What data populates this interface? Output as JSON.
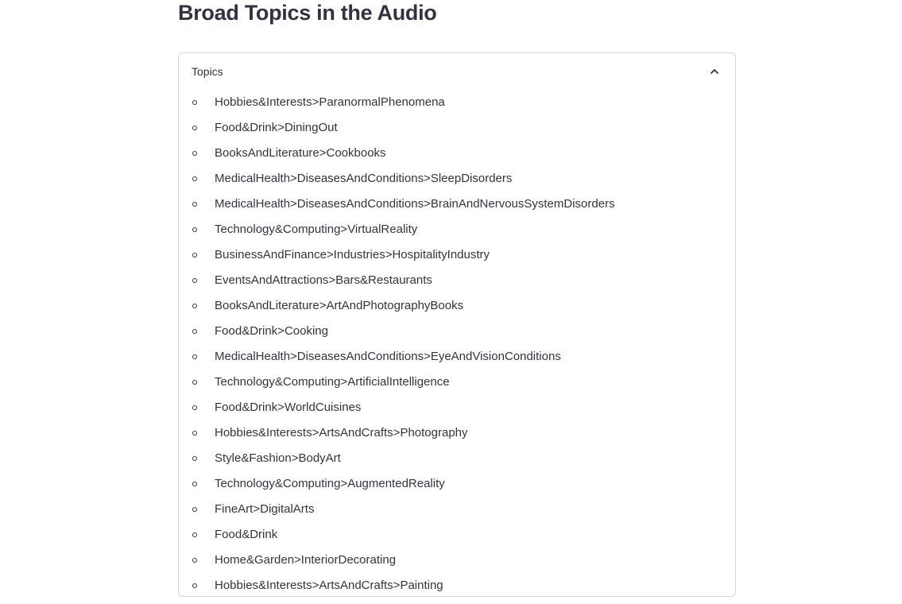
{
  "page": {
    "title": "Broad Topics in the Audio"
  },
  "expander": {
    "label": "Topics",
    "expanded": true,
    "toggle_icon": "chevron-up-icon",
    "items": [
      "Hobbies&Interests>ParanormalPhenomena",
      "Food&Drink>DiningOut",
      "BooksAndLiterature>Cookbooks",
      "MedicalHealth>DiseasesAndConditions>SleepDisorders",
      "MedicalHealth>DiseasesAndConditions>BrainAndNervousSystemDisorders",
      "Technology&Computing>VirtualReality",
      "BusinessAndFinance>Industries>HospitalityIndustry",
      "EventsAndAttractions>Bars&Restaurants",
      "BooksAndLiterature>ArtAndPhotographyBooks",
      "Food&Drink>Cooking",
      "MedicalHealth>DiseasesAndConditions>EyeAndVisionConditions",
      "Technology&Computing>ArtificialIntelligence",
      "Food&Drink>WorldCuisines",
      "Hobbies&Interests>ArtsAndCrafts>Photography",
      "Style&Fashion>BodyArt",
      "Technology&Computing>AugmentedReality",
      "FineArt>DigitalArts",
      "Food&Drink",
      "Home&Garden>InteriorDecorating",
      "Hobbies&Interests>ArtsAndCrafts>Painting"
    ]
  },
  "colors": {
    "text": "#31333f",
    "border": "#d6d6d9",
    "background": "#ffffff"
  }
}
